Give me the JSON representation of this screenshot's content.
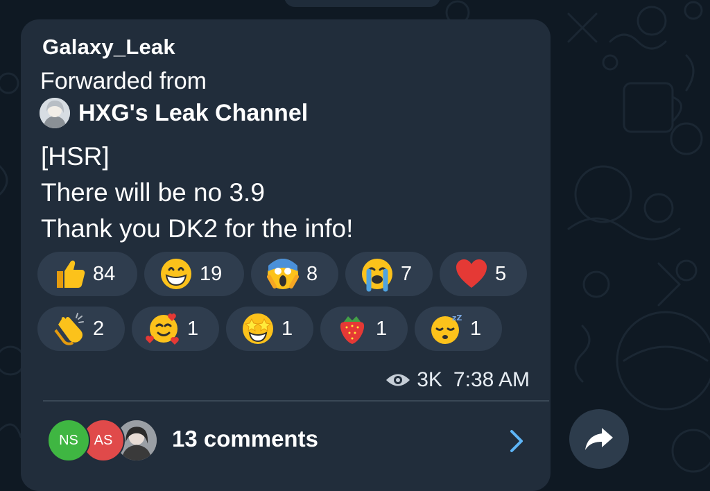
{
  "post": {
    "author": "Galaxy_Leak",
    "forwarded_label": "Forwarded from",
    "channel_name": "HXG's Leak Channel",
    "text_lines": [
      "[HSR]",
      "There will be no 3.9",
      "Thank you DK2 for the info!"
    ]
  },
  "reactions": [
    {
      "icon": "thumbs-up-icon",
      "count": "84"
    },
    {
      "icon": "grinning-face-icon",
      "count": "19"
    },
    {
      "icon": "screaming-face-icon",
      "count": "8"
    },
    {
      "icon": "crying-face-icon",
      "count": "7"
    },
    {
      "icon": "red-heart-icon",
      "count": "5"
    },
    {
      "icon": "clapping-hands-icon",
      "count": "2"
    },
    {
      "icon": "smiling-face-with-hearts-icon",
      "count": "1"
    },
    {
      "icon": "star-struck-icon",
      "count": "1"
    },
    {
      "icon": "strawberry-icon",
      "count": "1"
    },
    {
      "icon": "sleepy-face-icon",
      "count": "1"
    }
  ],
  "meta": {
    "views": "3K",
    "time": "7:38 AM"
  },
  "comments": {
    "avatars": [
      "NS",
      "AS"
    ],
    "label": "13 comments"
  },
  "colors": {
    "background": "#0f1923",
    "bubble": "#212d3b",
    "reaction_pill": "#2f3d4e",
    "link_blue": "#5eb5f7"
  }
}
